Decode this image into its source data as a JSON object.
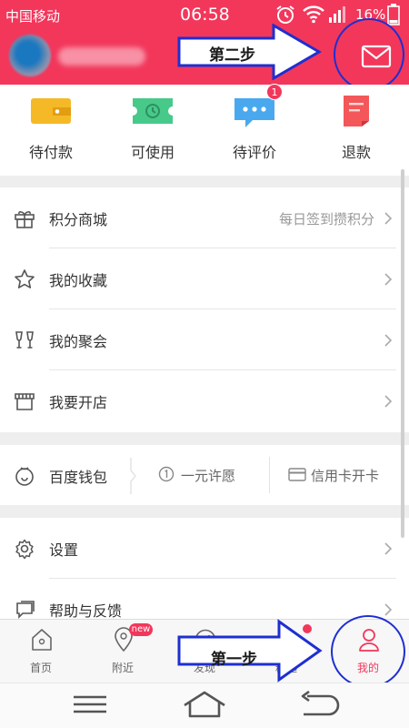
{
  "status_bar": {
    "carrier": "中国移动",
    "time": "06:58",
    "battery": "16%"
  },
  "header": {
    "message_icon": "mail-icon"
  },
  "annotations": {
    "step2": "第二步",
    "step1": "第一步"
  },
  "orders": [
    {
      "label": "待付款",
      "icon": "wallet-icon",
      "color": "#f5b928"
    },
    {
      "label": "可使用",
      "icon": "ticket-icon",
      "color": "#47c98a"
    },
    {
      "label": "待评价",
      "icon": "comment-icon",
      "color": "#4aa8ee",
      "badge": "1"
    },
    {
      "label": "退款",
      "icon": "refund-icon",
      "color": "#f4575a"
    }
  ],
  "menu": {
    "points_mall": {
      "label": "积分商城",
      "hint": "每日签到攒积分"
    },
    "favorites": {
      "label": "我的收藏"
    },
    "gatherings": {
      "label": "我的聚会"
    },
    "open_store": {
      "label": "我要开店"
    },
    "wallet": {
      "label": "百度钱包",
      "wish": "一元许愿",
      "credit_card": "信用卡开卡"
    },
    "settings": {
      "label": "设置"
    },
    "help": {
      "label": "帮助与反馈"
    }
  },
  "tabs": [
    {
      "label": "首页",
      "icon": "home-icon"
    },
    {
      "label": "附近",
      "icon": "location-icon",
      "badge": "new"
    },
    {
      "label": "发现",
      "icon": "compass-icon"
    },
    {
      "label": "精选",
      "icon": "basket-icon"
    },
    {
      "label": "我的",
      "icon": "user-icon",
      "active": true
    }
  ],
  "colors": {
    "brand": "#f2375b",
    "annotation": "#1e2fd1"
  }
}
